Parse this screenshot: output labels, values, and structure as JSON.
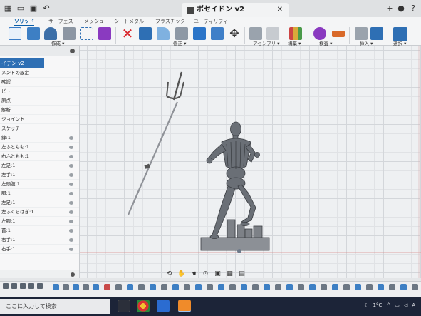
{
  "titlebar": {
    "tabs": [
      {
        "label": "ソリッド"
      },
      {
        "label": "サーフェス"
      },
      {
        "label": "メッシュ"
      },
      {
        "label": "シートメタル"
      },
      {
        "label": "プラスチック"
      },
      {
        "label": "ユーティリティ"
      }
    ],
    "document_title": "ポセイドン v2"
  },
  "ribbon": {
    "groups": [
      {
        "label": "作成 ▾"
      },
      {
        "label": "修正 ▾"
      },
      {
        "label": "アセンブリ ▾"
      },
      {
        "label": "構築 ▾"
      },
      {
        "label": "検査 ▾"
      },
      {
        "label": "挿入 ▾"
      },
      {
        "label": "選択 ▾"
      }
    ],
    "colors": {
      "accent": "#0b5ea8",
      "delete": "#d9262c",
      "selection": "#2e6fb4"
    }
  },
  "browser": {
    "root_label": "イデン v2",
    "rows": [
      {
        "label": "メントの設定"
      },
      {
        "label": "確認"
      },
      {
        "label": "ビュー"
      },
      {
        "label": "原点"
      },
      {
        "label": "解析"
      },
      {
        "label": "ジョイント"
      },
      {
        "label": "スケッチ"
      },
      {
        "label": "鉾:1"
      },
      {
        "label": "左ふともも:1"
      },
      {
        "label": "右ふともも:1"
      },
      {
        "label": "左足:1"
      },
      {
        "label": "左手:1"
      },
      {
        "label": "左頭肢:1"
      },
      {
        "label": "胴:1"
      },
      {
        "label": "左足:1"
      },
      {
        "label": "左ふくらはぎ:1"
      },
      {
        "label": "左腕:1"
      },
      {
        "label": "首:1"
      },
      {
        "label": "右手:1"
      },
      {
        "label": "右手:1"
      }
    ]
  },
  "navbar": {
    "icons": [
      "orbit-icon",
      "hand-icon",
      "pan-icon",
      "zoom-icon",
      "display-mode-icon",
      "grid-icon",
      "viewports-icon"
    ]
  },
  "taskbar": {
    "search_placeholder": "ここに入力して検索",
    "temperature": "1°C",
    "tray_text": "^"
  }
}
